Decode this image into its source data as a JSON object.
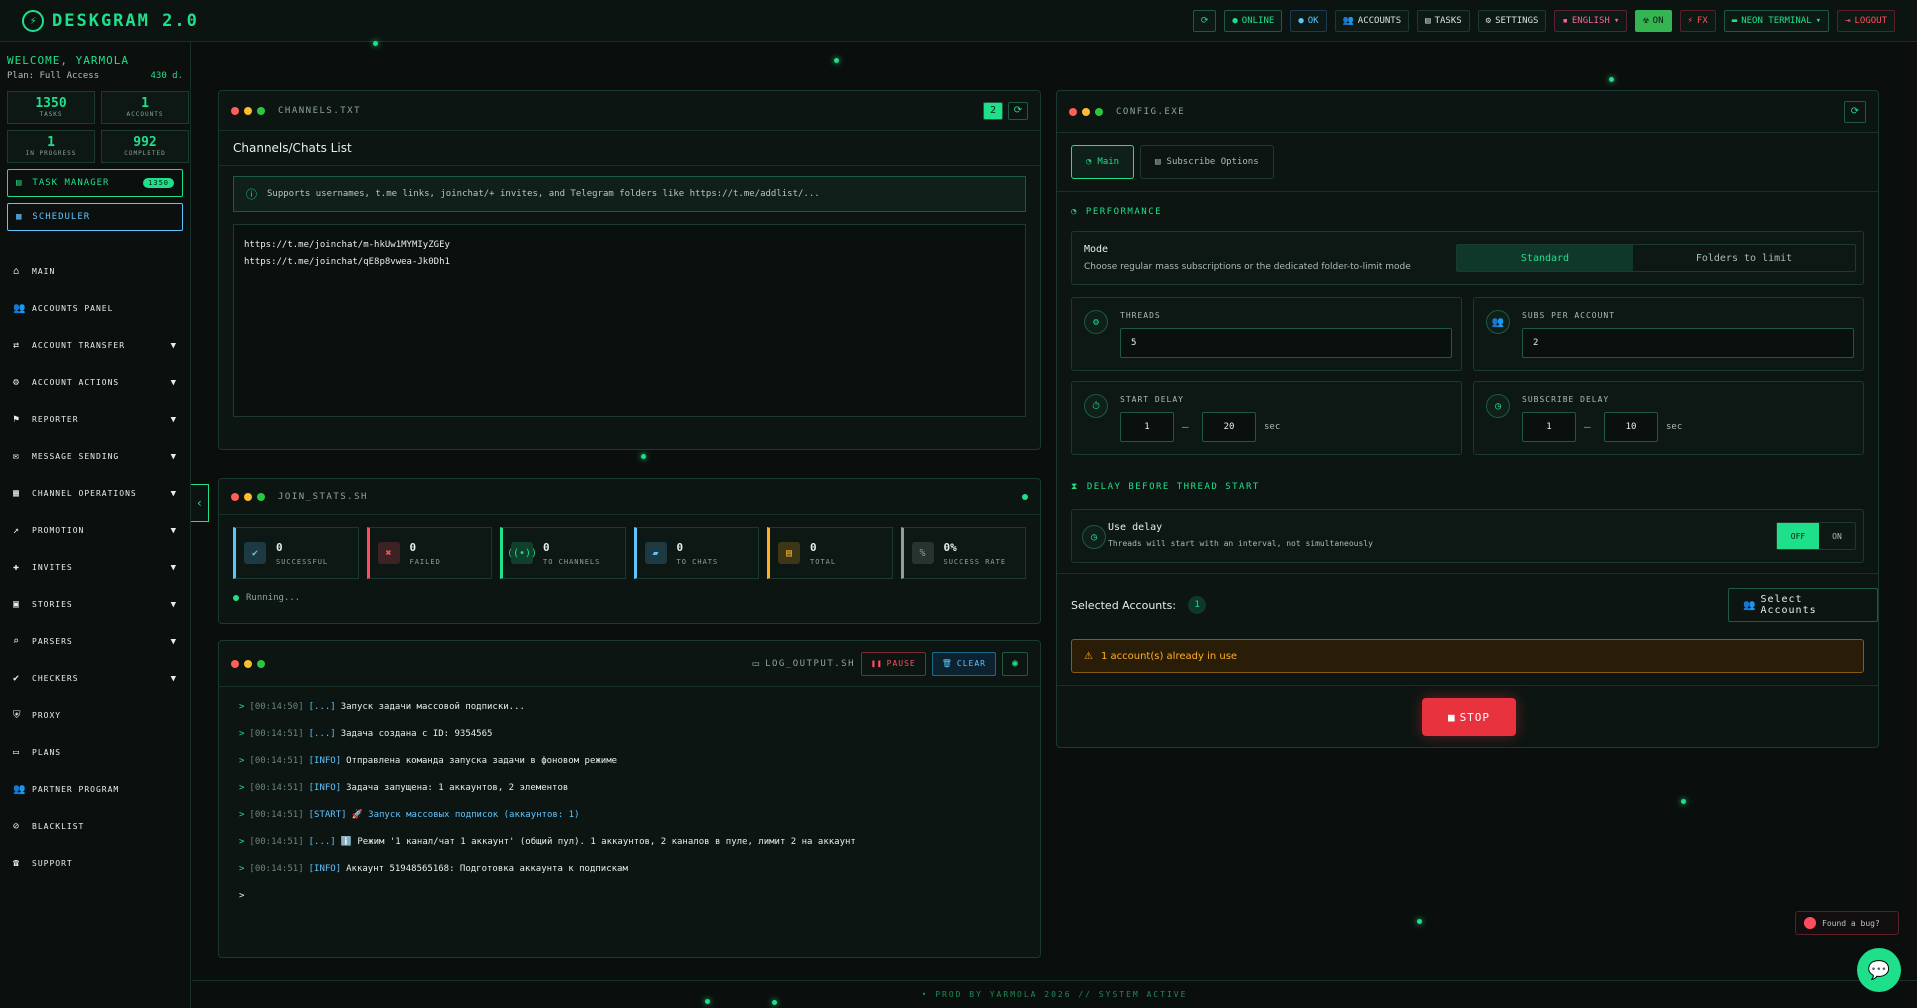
{
  "app": {
    "title": "DESKGRAM 2.0"
  },
  "topbar": {
    "status_online": "ONLINE",
    "status_ok": "OK",
    "accounts": "ACCOUNTS",
    "tasks": "TASKS",
    "settings": "SETTINGS",
    "language": "ENGLISH",
    "on": "ON",
    "fx": "FX",
    "theme": "NEON TERMINAL",
    "logout": "LOGOUT"
  },
  "sidebar": {
    "welcome": "WELCOME, YARMOLA",
    "plan": "Plan: Full Access",
    "days": "430 d.",
    "stats": [
      {
        "value": "1350",
        "label": "TASKS"
      },
      {
        "value": "1",
        "label": "ACCOUNTS"
      },
      {
        "value": "1",
        "label": "IN PROGRESS"
      },
      {
        "value": "992",
        "label": "COMPLETED"
      }
    ],
    "task_manager": "TASK MANAGER",
    "task_manager_badge": "1350",
    "scheduler": "SCHEDULER",
    "items": [
      {
        "label": "MAIN",
        "icon": "home-icon",
        "glyph": "⌂",
        "chev": false
      },
      {
        "label": "ACCOUNTS PANEL",
        "icon": "users-icon",
        "glyph": "👥",
        "chev": false
      },
      {
        "label": "ACCOUNT TRANSFER",
        "icon": "transfer-icon",
        "glyph": "⇄",
        "chev": true
      },
      {
        "label": "ACCOUNT ACTIONS",
        "icon": "user-gear-icon",
        "glyph": "⚙",
        "chev": true
      },
      {
        "label": "REPORTER",
        "icon": "flag-icon",
        "glyph": "⚑",
        "chev": true
      },
      {
        "label": "MESSAGE SENDING",
        "icon": "chat-icon",
        "glyph": "✉",
        "chev": true
      },
      {
        "label": "CHANNEL OPERATIONS",
        "icon": "building-icon",
        "glyph": "▦",
        "chev": true
      },
      {
        "label": "PROMOTION",
        "icon": "chart-icon",
        "glyph": "↗",
        "chev": true
      },
      {
        "label": "INVITES",
        "icon": "invite-icon",
        "glyph": "✚",
        "chev": true
      },
      {
        "label": "STORIES",
        "icon": "stories-icon",
        "glyph": "▣",
        "chev": true
      },
      {
        "label": "PARSERS",
        "icon": "search-icon",
        "glyph": "⌕",
        "chev": true
      },
      {
        "label": "CHECKERS",
        "icon": "check-circle-icon",
        "glyph": "✔",
        "chev": true
      },
      {
        "label": "PROXY",
        "icon": "shield-icon",
        "glyph": "⛨",
        "chev": false
      },
      {
        "label": "PLANS",
        "icon": "wallet-icon",
        "glyph": "▭",
        "chev": false
      },
      {
        "label": "PARTNER PROGRAM",
        "icon": "partners-icon",
        "glyph": "👥",
        "chev": false
      },
      {
        "label": "BLACKLIST",
        "icon": "user-block-icon",
        "glyph": "⊘",
        "chev": false
      },
      {
        "label": "SUPPORT",
        "icon": "headset-icon",
        "glyph": "☎",
        "chev": false
      }
    ]
  },
  "channels_panel": {
    "title": "CHANNELS.TXT",
    "count_badge": "2",
    "subtitle": "Channels/Chats List",
    "info": "Supports usernames, t.me links, joinchat/+ invites, and Telegram folders like https://t.me/addlist/...",
    "lines": [
      "https://t.me/joinchat/m-hkUw1MYMIyZGEy",
      "https://t.me/joinchat/qE8p8vwea-Jk0Dh1"
    ]
  },
  "join_stats": {
    "title": "JOIN_STATS.SH",
    "cards": [
      {
        "value": "0",
        "label": "SUCCESSFUL",
        "color": "#5ec4ff",
        "glyph": "✔"
      },
      {
        "value": "0",
        "label": "FAILED",
        "color": "#ff4d5e",
        "glyph": "✖"
      },
      {
        "value": "0",
        "label": "TO CHANNELS",
        "color": "#1ee08a",
        "glyph": "((•))"
      },
      {
        "value": "0",
        "label": "TO CHATS",
        "color": "#5ec4ff",
        "glyph": "▰"
      },
      {
        "value": "0",
        "label": "TOTAL",
        "color": "#ffb020",
        "glyph": "▤"
      },
      {
        "value": "0%",
        "label": "SUCCESS RATE",
        "color": "#8da096",
        "glyph": "%"
      }
    ],
    "status": "Running..."
  },
  "log": {
    "title": "LOG_OUTPUT.SH",
    "pause": "PAUSE",
    "clear": "CLEAR",
    "lines": [
      {
        "ts": "[00:14:50]",
        "tag": "[...]",
        "msg": "Запуск задачи массовой подписки...",
        "cyan": false
      },
      {
        "ts": "[00:14:51]",
        "tag": "[...]",
        "msg": "Задача создана с ID: 9354565",
        "cyan": false
      },
      {
        "ts": "[00:14:51]",
        "tag": "[INFO]",
        "msg": "Отправлена команда запуска задачи в фоновом режиме",
        "cyan": false
      },
      {
        "ts": "[00:14:51]",
        "tag": "[INFO]",
        "msg": "Задача запущена: 1 аккаунтов, 2 элементов",
        "cyan": false
      },
      {
        "ts": "[00:14:51]",
        "tag": "[START]",
        "msg": "🚀 Запуск массовых подписок (аккаунтов: 1)",
        "cyan": true
      },
      {
        "ts": "[00:14:51]",
        "tag": "[...]",
        "msg": "ℹ️ Режим '1 канал/чат 1 аккаунт' (общий пул). 1 аккаунтов, 2 каналов в пуле, лимит 2 на аккаунт",
        "cyan": false
      },
      {
        "ts": "[00:14:51]",
        "tag": "[INFO]",
        "msg": "Аккаунт 51948565168: Подготовка аккаунта к подпискам",
        "cyan": false
      }
    ],
    "prompt": ">"
  },
  "config": {
    "title": "CONFIG.EXE",
    "tab_main": "Main",
    "tab_subscribe": "Subscribe Options",
    "performance": "PERFORMANCE",
    "mode_label": "Mode",
    "mode_desc": "Choose regular mass subscriptions or the dedicated folder-to-limit mode",
    "mode_standard": "Standard",
    "mode_folders": "Folders to limit",
    "threads_label": "THREADS",
    "threads_value": "5",
    "subs_label": "SUBS PER ACCOUNT",
    "subs_value": "2",
    "start_delay_label": "START DELAY",
    "start_delay_min": "1",
    "start_delay_max": "20",
    "subscribe_delay_label": "SUBSCRIBE DELAY",
    "subscribe_delay_min": "1",
    "subscribe_delay_max": "10",
    "sec": "sec",
    "dash": "—",
    "delay_section": "DELAY BEFORE THREAD START",
    "use_delay": "Use delay",
    "use_delay_desc": "Threads will start with an interval, not simultaneously",
    "off": "OFF",
    "on": "ON",
    "selected_accounts": "Selected Accounts:",
    "selected_count": "1",
    "select_accounts": "Select Accounts",
    "warning": "1 account(s) already in use",
    "stop": "STOP"
  },
  "footer": "• PROD BY YARMOLA 2026   // SYSTEM ACTIVE",
  "bug": "Found a bug?"
}
